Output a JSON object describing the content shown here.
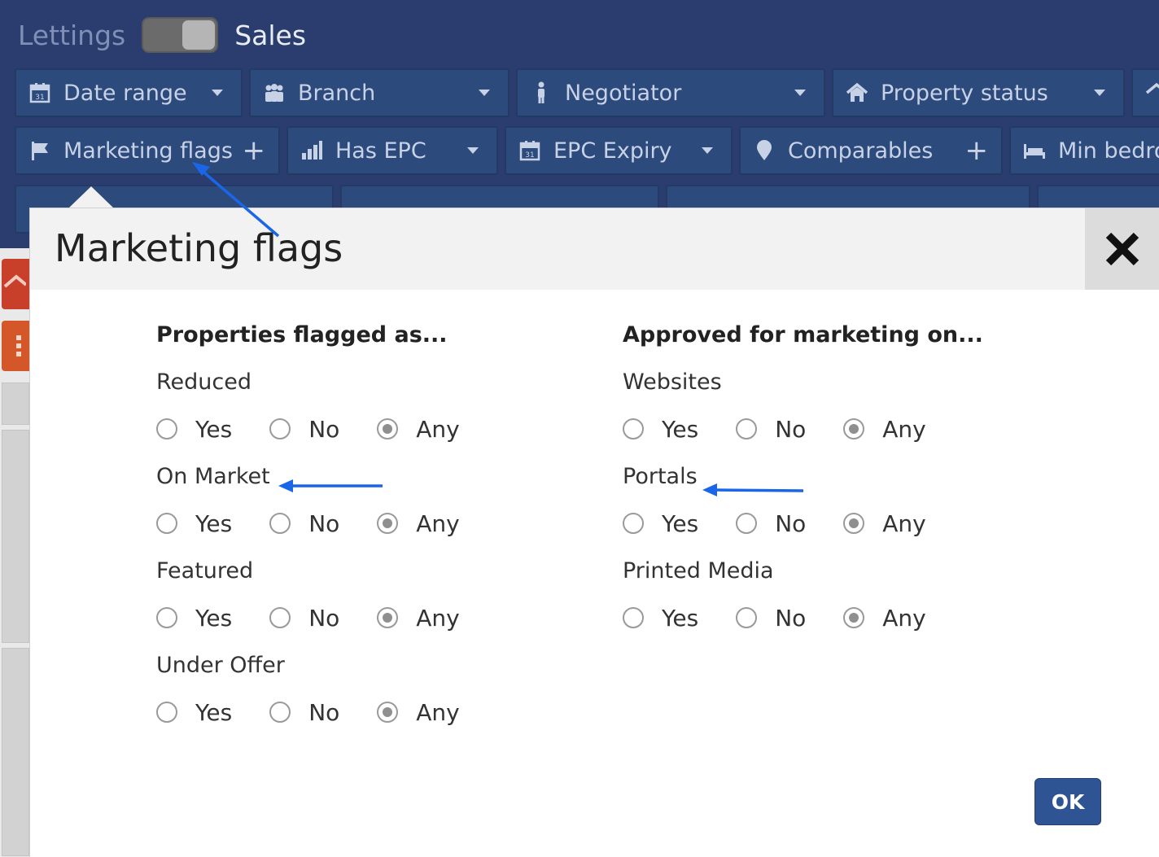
{
  "mode": {
    "left_label": "Lettings",
    "right_label": "Sales"
  },
  "filters": {
    "row1": [
      {
        "label": "Date range",
        "icon": "calendar-icon",
        "control": "caret"
      },
      {
        "label": "Branch",
        "icon": "people-icon",
        "control": "caret"
      },
      {
        "label": "Negotiator",
        "icon": "person-icon",
        "control": "caret"
      },
      {
        "label": "Property status",
        "icon": "home-icon",
        "control": "caret"
      }
    ],
    "row2": [
      {
        "label": "Marketing flags",
        "icon": "flag-icon",
        "control": "plus"
      },
      {
        "label": "Has EPC",
        "icon": "bar-chart-icon",
        "control": "caret"
      },
      {
        "label": "EPC Expiry",
        "icon": "calendar-icon",
        "control": "caret"
      },
      {
        "label": "Comparables",
        "icon": "map-pin-icon",
        "control": "plus"
      },
      {
        "label": "Min bedroo",
        "icon": "bed-icon",
        "control": "none"
      }
    ]
  },
  "modal": {
    "title": "Marketing flags",
    "close_icon": "close-icon",
    "ok_label": "OK",
    "options": [
      "Yes",
      "No",
      "Any"
    ],
    "left": {
      "heading": "Properties flagged as...",
      "groups": [
        {
          "label": "Reduced",
          "selected": "Any"
        },
        {
          "label": "On Market",
          "selected": "Any"
        },
        {
          "label": "Featured",
          "selected": "Any"
        },
        {
          "label": "Under Offer",
          "selected": "Any"
        }
      ]
    },
    "right": {
      "heading": "Approved for marketing on...",
      "groups": [
        {
          "label": "Websites",
          "selected": "Any"
        },
        {
          "label": "Portals",
          "selected": "Any"
        },
        {
          "label": "Printed Media",
          "selected": "Any"
        }
      ]
    }
  },
  "colors": {
    "topbar": "#2a3d6e",
    "filter_button": "#2d4a7c",
    "ok_button": "#2f5494",
    "annotation_arrow": "#1a66e8"
  }
}
